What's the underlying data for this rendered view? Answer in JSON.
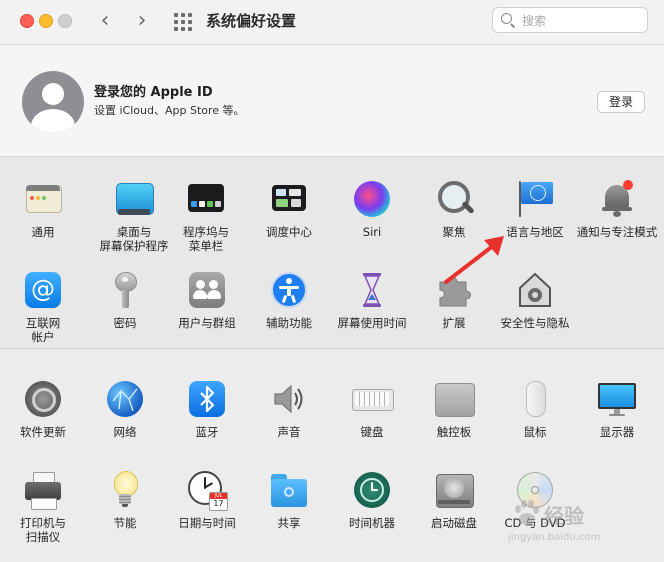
{
  "window": {
    "title": "系统偏好设置",
    "search": {
      "placeholder": "搜索",
      "value": ""
    }
  },
  "account": {
    "title": "登录您的 Apple ID",
    "subtitle": "设置 iCloud、App Store 等。",
    "login_label": "登录"
  },
  "section1": [
    {
      "id": "general",
      "label": "通用",
      "icon": "general-icon"
    },
    {
      "id": "desktop",
      "label": "桌面与\n屏幕保护程序",
      "icon": "desktop-screensaver-icon"
    },
    {
      "id": "dock",
      "label": "程序坞与\n菜单栏",
      "icon": "dock-menubar-icon"
    },
    {
      "id": "mission",
      "label": "调度中心",
      "icon": "mission-control-icon"
    },
    {
      "id": "siri",
      "label": "Siri",
      "icon": "siri-icon"
    },
    {
      "id": "spotlight",
      "label": "聚焦",
      "icon": "spotlight-icon"
    },
    {
      "id": "language",
      "label": "语言与地区",
      "icon": "language-region-icon"
    },
    {
      "id": "notifications",
      "label": "通知与专注模式",
      "icon": "notifications-icon"
    },
    {
      "id": "internet",
      "label": "互联网\n帐户",
      "icon": "internet-accounts-icon"
    },
    {
      "id": "passwords",
      "label": "密码",
      "icon": "key-icon"
    },
    {
      "id": "users",
      "label": "用户与群组",
      "icon": "users-groups-icon"
    },
    {
      "id": "accessibility",
      "label": "辅助功能",
      "icon": "accessibility-icon"
    },
    {
      "id": "screentime",
      "label": "屏幕使用时间",
      "icon": "hourglass-icon"
    },
    {
      "id": "extensions",
      "label": "扩展",
      "icon": "puzzle-icon"
    },
    {
      "id": "security",
      "label": "安全性与隐私",
      "icon": "security-house-icon"
    }
  ],
  "section2": [
    {
      "id": "softwareupdate",
      "label": "软件更新",
      "icon": "software-update-icon"
    },
    {
      "id": "network",
      "label": "网络",
      "icon": "network-globe-icon"
    },
    {
      "id": "bluetooth",
      "label": "蓝牙",
      "icon": "bluetooth-icon"
    },
    {
      "id": "sound",
      "label": "声音",
      "icon": "speaker-icon"
    },
    {
      "id": "keyboard",
      "label": "键盘",
      "icon": "keyboard-icon"
    },
    {
      "id": "trackpad",
      "label": "触控板",
      "icon": "trackpad-icon"
    },
    {
      "id": "mouse",
      "label": "鼠标",
      "icon": "mouse-icon"
    },
    {
      "id": "displays",
      "label": "显示器",
      "icon": "display-icon"
    },
    {
      "id": "printers",
      "label": "打印机与\n扫描仪",
      "icon": "printer-icon"
    },
    {
      "id": "energy",
      "label": "节能",
      "icon": "lightbulb-icon"
    },
    {
      "id": "datetime",
      "label": "日期与时间",
      "icon": "clock-calendar-icon"
    },
    {
      "id": "sharing",
      "label": "共享",
      "icon": "sharing-folder-icon"
    },
    {
      "id": "timemachine",
      "label": "时间机器",
      "icon": "time-machine-icon"
    },
    {
      "id": "startupdisk",
      "label": "启动磁盘",
      "icon": "startup-disk-icon"
    },
    {
      "id": "cds",
      "label": "CD 与 DVD",
      "icon": "cd-dvd-icon"
    }
  ],
  "calendar_badge": {
    "month": "JUL",
    "day": "17"
  },
  "watermark": {
    "text": "经验",
    "url_text": "jingyan.baidu.com"
  },
  "colors": {
    "arrow": "#e8312a",
    "accent": "#0a84ff"
  }
}
